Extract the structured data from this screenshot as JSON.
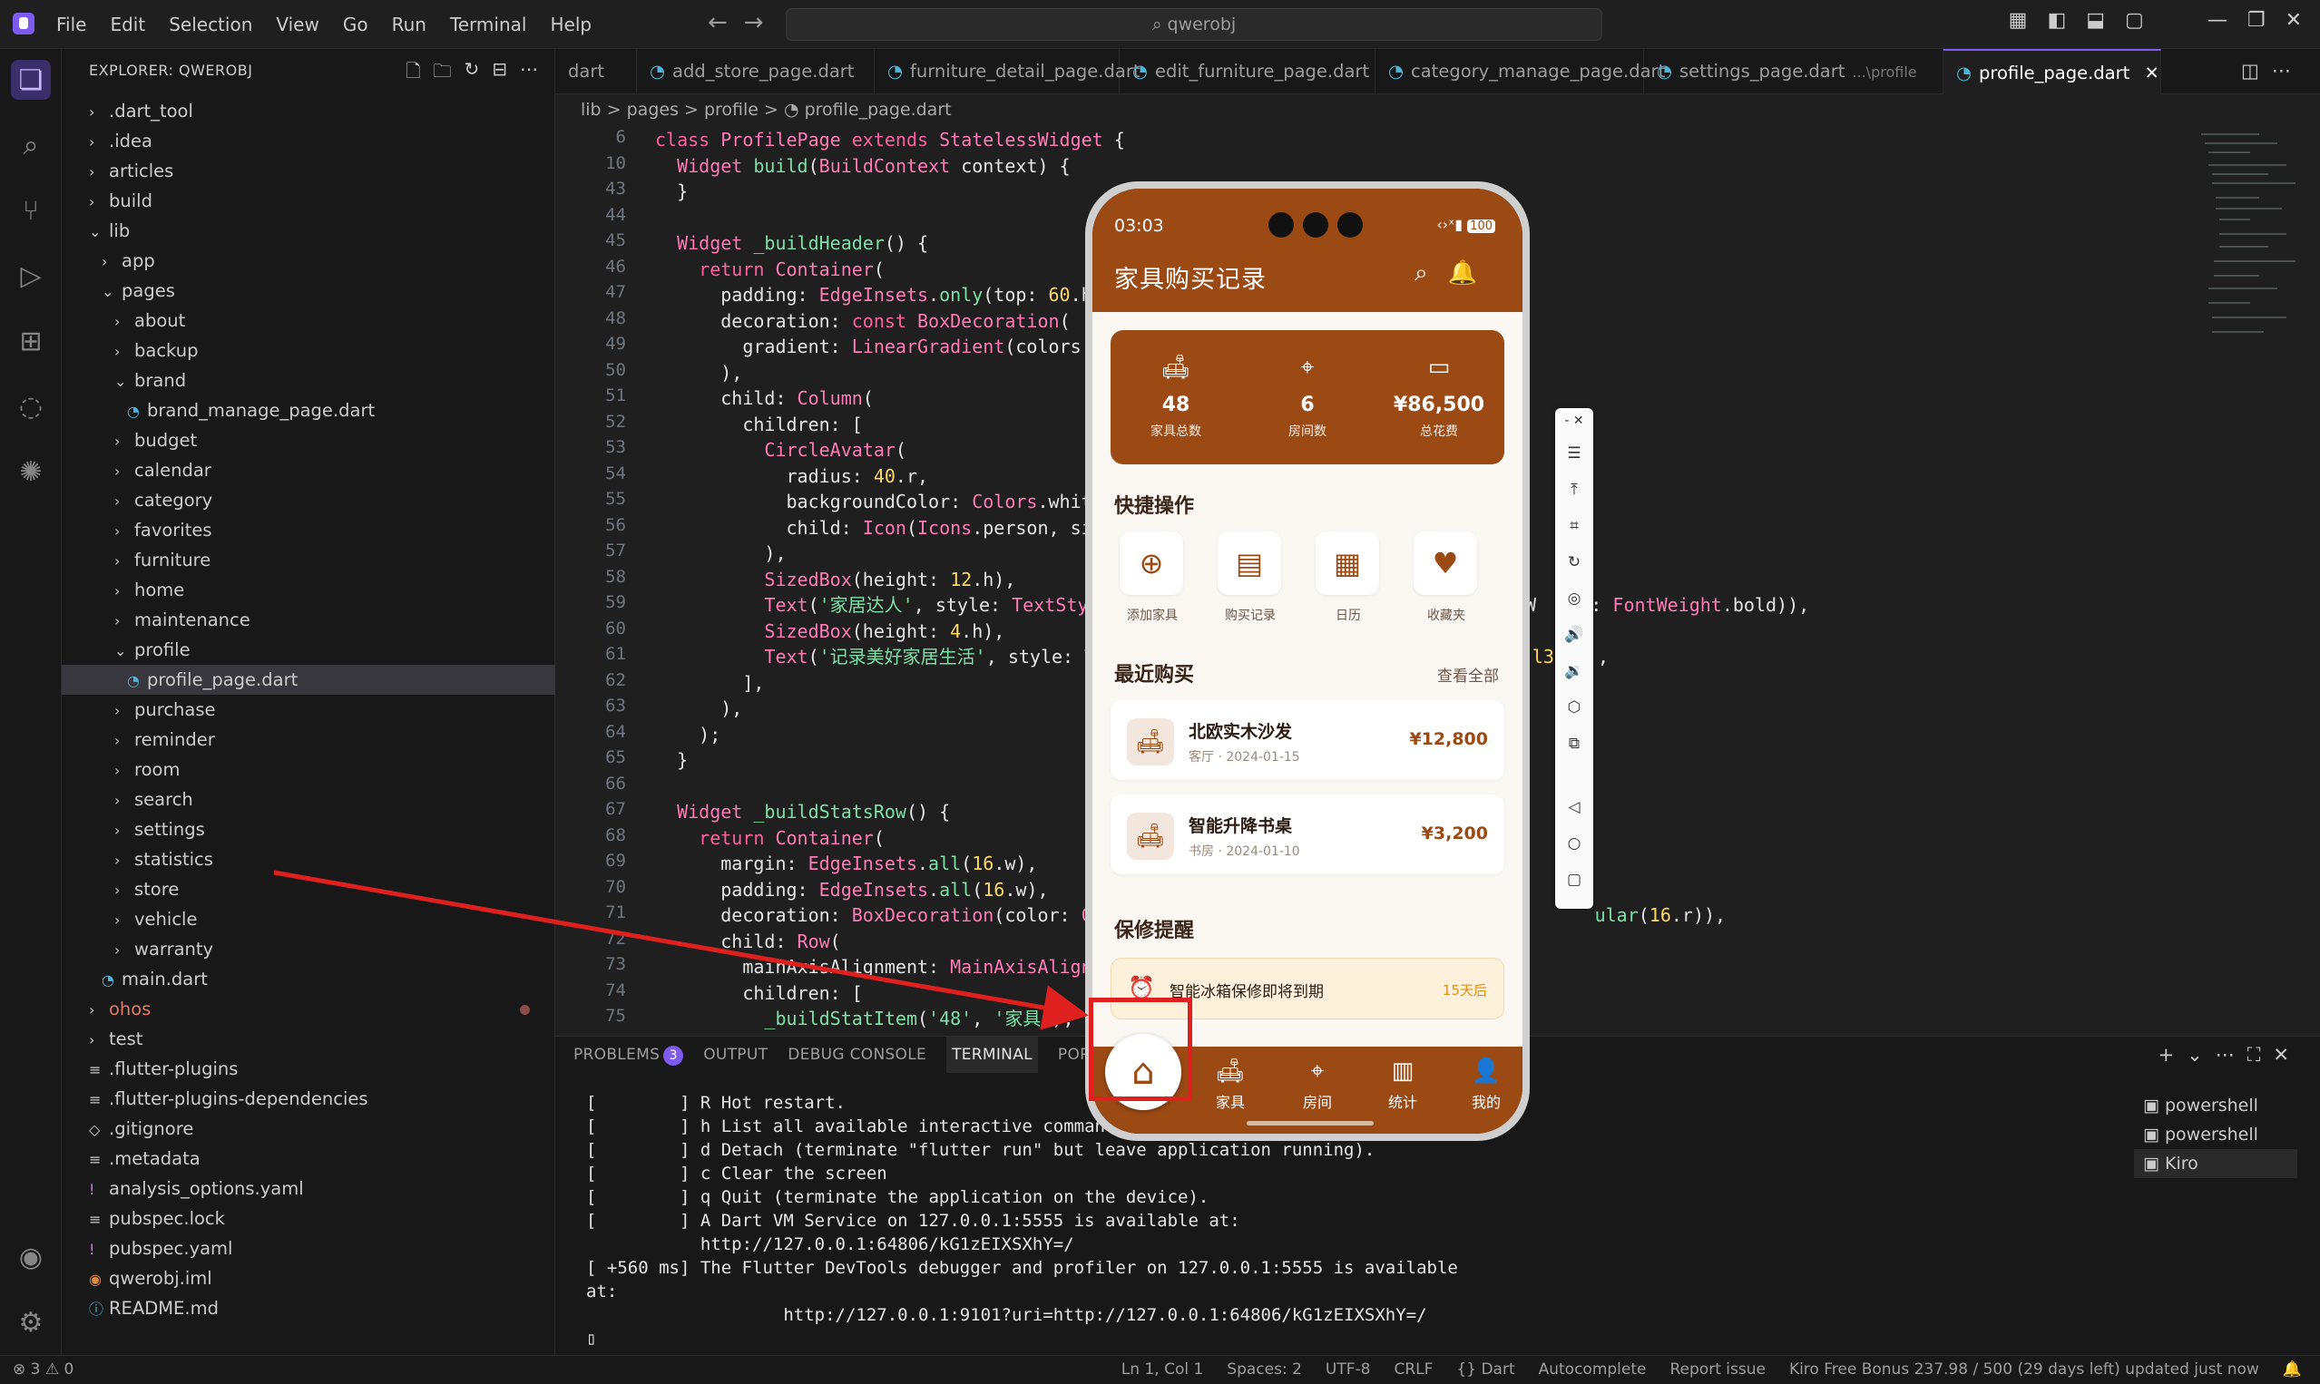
{
  "titlebar": {
    "menu": [
      "File",
      "Edit",
      "Selection",
      "View",
      "Go",
      "Run",
      "Terminal",
      "Help"
    ],
    "search": "qwerobj"
  },
  "sidebar": {
    "title": "EXPLORER: QWEROBJ",
    "tree": [
      {
        "label": ".dart_tool",
        "indent": 0,
        "chev": ">"
      },
      {
        "label": ".idea",
        "indent": 0,
        "chev": ">"
      },
      {
        "label": "articles",
        "indent": 0,
        "chev": ">"
      },
      {
        "label": "build",
        "indent": 0,
        "chev": ">"
      },
      {
        "label": "lib",
        "indent": 0,
        "chev": "v"
      },
      {
        "label": "app",
        "indent": 1,
        "chev": ">"
      },
      {
        "label": "pages",
        "indent": 1,
        "chev": "v"
      },
      {
        "label": "about",
        "indent": 2,
        "chev": ">"
      },
      {
        "label": "backup",
        "indent": 2,
        "chev": ">"
      },
      {
        "label": "brand",
        "indent": 2,
        "chev": "v"
      },
      {
        "label": "brand_manage_page.dart",
        "indent": 3,
        "chev": "dart"
      },
      {
        "label": "budget",
        "indent": 2,
        "chev": ">"
      },
      {
        "label": "calendar",
        "indent": 2,
        "chev": ">"
      },
      {
        "label": "category",
        "indent": 2,
        "chev": ">"
      },
      {
        "label": "favorites",
        "indent": 2,
        "chev": ">"
      },
      {
        "label": "furniture",
        "indent": 2,
        "chev": ">"
      },
      {
        "label": "home",
        "indent": 2,
        "chev": ">"
      },
      {
        "label": "maintenance",
        "indent": 2,
        "chev": ">"
      },
      {
        "label": "profile",
        "indent": 2,
        "chev": "v"
      },
      {
        "label": "profile_page.dart",
        "indent": 3,
        "chev": "dart",
        "selected": true
      },
      {
        "label": "purchase",
        "indent": 2,
        "chev": ">"
      },
      {
        "label": "reminder",
        "indent": 2,
        "chev": ">"
      },
      {
        "label": "room",
        "indent": 2,
        "chev": ">"
      },
      {
        "label": "search",
        "indent": 2,
        "chev": ">"
      },
      {
        "label": "settings",
        "indent": 2,
        "chev": ">"
      },
      {
        "label": "statistics",
        "indent": 2,
        "chev": ">"
      },
      {
        "label": "store",
        "indent": 2,
        "chev": ">"
      },
      {
        "label": "vehicle",
        "indent": 2,
        "chev": ">"
      },
      {
        "label": "warranty",
        "indent": 2,
        "chev": ">"
      },
      {
        "label": "main.dart",
        "indent": 1,
        "chev": "dart"
      },
      {
        "label": "ohos",
        "indent": 0,
        "chev": ">",
        "color": "#e07a6a",
        "badge": true
      },
      {
        "label": "test",
        "indent": 0,
        "chev": ">"
      },
      {
        "label": ".flutter-plugins",
        "indent": 0,
        "chev": "≡"
      },
      {
        "label": ".flutter-plugins-dependencies",
        "indent": 0,
        "chev": "≡"
      },
      {
        "label": ".gitignore",
        "indent": 0,
        "chev": "◇"
      },
      {
        "label": ".metadata",
        "indent": 0,
        "chev": "≡"
      },
      {
        "label": "analysis_options.yaml",
        "indent": 0,
        "chev": "!"
      },
      {
        "label": "pubspec.lock",
        "indent": 0,
        "chev": "≡"
      },
      {
        "label": "pubspec.yaml",
        "indent": 0,
        "chev": "!"
      },
      {
        "label": "qwerobj.iml",
        "indent": 0,
        "chev": "rss"
      },
      {
        "label": "README.md",
        "indent": 0,
        "chev": "ⓘ"
      }
    ]
  },
  "tabs": [
    {
      "label": "dart",
      "icon": false
    },
    {
      "label": "add_store_page.dart",
      "icon": true
    },
    {
      "label": "furniture_detail_page.dart",
      "icon": true
    },
    {
      "label": "edit_furniture_page.dart",
      "icon": true
    },
    {
      "label": "category_manage_page.dart",
      "icon": true
    },
    {
      "label": "settings_page.dart",
      "suffix": "...\\profile",
      "icon": true
    },
    {
      "label": "profile_page.dart",
      "icon": true,
      "active": true
    }
  ],
  "breadcrumb": "lib > pages > profile > ◔ profile_page.dart",
  "editor": {
    "lines": [
      {
        "n": "6",
        "html": "<span class='kw'>class</span> <span class='ty'>ProfilePage</span> <span class='kw'>extends</span> <span class='ty'>StatelessWidget</span> {"
      },
      {
        "n": "10",
        "html": "  <span class='ty'>Widget</span> <span class='fn'>build</span>(<span class='ty'>BuildContext</span> context) {"
      },
      {
        "n": "43",
        "html": "  }"
      },
      {
        "n": "44",
        "html": ""
      },
      {
        "n": "45",
        "html": "  <span class='ty'>Widget</span> <span class='fn'>_buildHeader</span>() {"
      },
      {
        "n": "46",
        "html": "    <span class='kw'>return</span> <span class='ty'>Container</span>("
      },
      {
        "n": "47",
        "html": "      padding: <span class='ty'>EdgeInsets</span>.<span class='fn'>only</span>(top: <span class='num'>60</span>.h,"
      },
      {
        "n": "48",
        "html": "      decoration: <span class='kw'>const</span> <span class='ty'>BoxDecoration</span>("
      },
      {
        "n": "49",
        "html": "        gradient: <span class='ty'>LinearGradient</span>(colors:"
      },
      {
        "n": "50",
        "html": "      ),"
      },
      {
        "n": "51",
        "html": "      child: <span class='ty'>Column</span>("
      },
      {
        "n": "52",
        "html": "        children: ["
      },
      {
        "n": "53",
        "html": "          <span class='ty'>CircleAvatar</span>("
      },
      {
        "n": "54",
        "html": "            radius: <span class='num'>40</span>.r,"
      },
      {
        "n": "55",
        "html": "            backgroundColor: <span class='ty'>Colors</span>.white"
      },
      {
        "n": "56",
        "html": "            child: <span class='ty'>Icon</span>(<span class='ty'>Icons</span>.person, siz"
      },
      {
        "n": "57",
        "html": "          ),"
      },
      {
        "n": "58",
        "html": "          <span class='ty'>SizedBox</span>(height: <span class='num'>12</span>.h),"
      },
      {
        "n": "59",
        "html": "          <span class='ty'>Text</span>(<span class='str'>'家居达人'</span>, style: <span class='ty'>TextStyl</span>                                      <span class='pr'>tW</span>    <span class='pr'>t:</span> <span class='ty'>FontWeight</span>.bold)),"
      },
      {
        "n": "60",
        "html": "          <span class='ty'>SizedBox</span>(height: <span class='num'>4</span>.h),"
      },
      {
        "n": "61",
        "html": "          <span class='ty'>Text</span>(<span class='str'>'记录美好家居生活'</span>, style: <span class='ty'>T</span>                                        <span class='num'>l3</span>.   ,"
      },
      {
        "n": "62",
        "html": "        ],"
      },
      {
        "n": "63",
        "html": "      ),"
      },
      {
        "n": "64",
        "html": "    );"
      },
      {
        "n": "65",
        "html": "  }"
      },
      {
        "n": "66",
        "html": ""
      },
      {
        "n": "67",
        "html": "  <span class='ty'>Widget</span> <span class='fn'>_buildStatsRow</span>() {"
      },
      {
        "n": "68",
        "html": "    <span class='kw'>return</span> <span class='ty'>Container</span>("
      },
      {
        "n": "69",
        "html": "      margin: <span class='ty'>EdgeInsets</span>.<span class='fn'>all</span>(<span class='num'>16</span>.w),"
      },
      {
        "n": "70",
        "html": "      padding: <span class='ty'>EdgeInsets</span>.<span class='fn'>all</span>(<span class='num'>16</span>.w),"
      },
      {
        "n": "71",
        "html": "      decoration: <span class='ty'>BoxDecoration</span>(color: <span class='ty'>Co</span>                                             <span class='fn'>ular</span>(<span class='num'>16</span>.r)),"
      },
      {
        "n": "72",
        "html": "      child: <span class='ty'>Row</span>("
      },
      {
        "n": "73",
        "html": "        mainAxisAlignment: <span class='ty'>MainAxisAlignm</span>"
      },
      {
        "n": "74",
        "html": "        children: ["
      },
      {
        "n": "75",
        "html": "          <span class='fn'>_buildStatItem</span>(<span class='str'>'48'</span>, <span class='str'>'家具'</span>),"
      }
    ]
  },
  "panel": {
    "tabs": [
      "PROBLEMS",
      "OUTPUT",
      "DEBUG CONSOLE",
      "TERMINAL",
      "PORTS"
    ],
    "problems_count": "3",
    "terminal": "[        ] R Hot restart.\n[        ] h List all available interactive commands.\n[        ] d Detach (terminate \"flutter run\" but leave application running).\n[        ] c Clear the screen\n[        ] q Quit (terminate the application on the device).\n[        ] A Dart VM Service on 127.0.0.1:5555 is available at:\n           http://127.0.0.1:64806/kG1zEIXSXhY=/\n[ +560 ms] The Flutter DevTools debugger and profiler on 127.0.0.1:5555 is available\nat:\n                   http://127.0.0.1:9101?uri=http://127.0.0.1:64806/kG1zEIXSXhY=/\n▯",
    "terminals": [
      "powershell",
      "powershell",
      "Kiro"
    ]
  },
  "status": {
    "left": "⊗ 3 ⚠ 0",
    "right": [
      "Ln 1, Col 1",
      "Spaces: 2",
      "UTF-8",
      "CRLF",
      "{} Dart",
      "Autocomplete",
      "Report issue",
      "Kiro Free Bonus 237.98 / 500 (29 days left) updated just now"
    ]
  },
  "phone": {
    "time": "03:03",
    "battery": "100",
    "title": "家具购买记录",
    "stats": [
      {
        "icon": "sofa-icon",
        "value": "48",
        "label": "家具总数"
      },
      {
        "icon": "location-pin-icon",
        "value": "6",
        "label": "房间数"
      },
      {
        "icon": "card-icon",
        "value": "¥86,500",
        "label": "总花费"
      }
    ],
    "quick_title": "快捷操作",
    "quick": [
      {
        "icon": "add-circle-icon",
        "label": "添加家具"
      },
      {
        "icon": "receipt-icon",
        "label": "购买记录"
      },
      {
        "icon": "calendar-icon",
        "label": "日历"
      },
      {
        "icon": "heart-icon",
        "label": "收藏夹"
      }
    ],
    "recent_title": "最近购买",
    "view_all": "查看全部",
    "purchases": [
      {
        "name": "北欧实木沙发",
        "meta": "客厅 · 2024-01-15",
        "price": "¥12,800"
      },
      {
        "name": "智能升降书桌",
        "meta": "书房 · 2024-01-10",
        "price": "¥3,200"
      }
    ],
    "warranty_title": "保修提醒",
    "warranty_item": "智能冰箱保修即将到期",
    "warranty_days": "15天后",
    "nav": [
      "家具",
      "房间",
      "统计",
      "我的"
    ]
  },
  "colors": {
    "brand": "#9c4a14",
    "accent": "#7f5af0",
    "annotation": "#e0201f"
  }
}
